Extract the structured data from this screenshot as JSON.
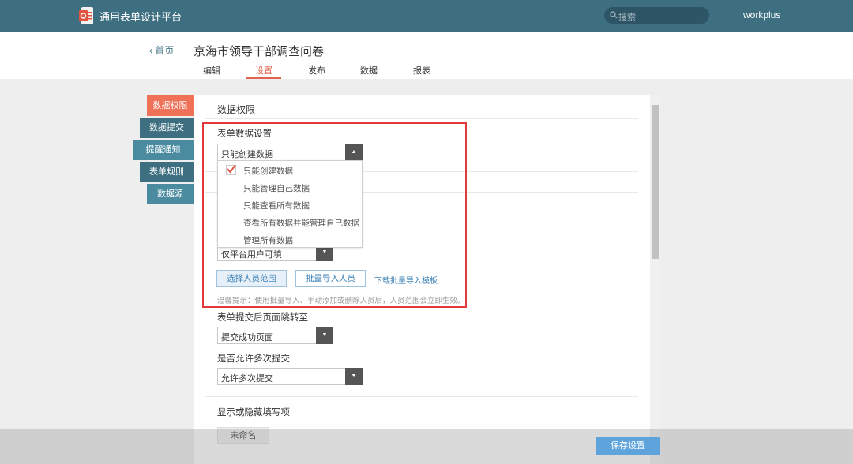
{
  "app": {
    "title": "通用表单设计平台"
  },
  "header": {
    "search_placeholder": "搜索",
    "user": "workplus"
  },
  "nav": {
    "back": "首页",
    "page_title": "京海市领导干部调查问卷"
  },
  "tabs": [
    {
      "label": "编辑"
    },
    {
      "label": "设置",
      "active": true
    },
    {
      "label": "发布"
    },
    {
      "label": "数据"
    },
    {
      "label": "报表"
    }
  ],
  "sidebar": [
    {
      "label": "数据权限",
      "active": true
    },
    {
      "label": "数据提交"
    },
    {
      "label": "提醒通知"
    },
    {
      "label": "表单规则"
    },
    {
      "label": "数据源"
    }
  ],
  "section": {
    "title": "数据权限",
    "form_data_label": "表单数据设置",
    "form_data_value": "只能创建数据",
    "options": [
      "只能创建数据",
      "只能管理自己数据",
      "只能查看所有数据",
      "查看所有数据并能管理自己数据",
      "管理所有数据"
    ],
    "fill_scope_value": "仅平台用户可填",
    "select_range_button": "选择人员范围",
    "batch_import_button": "批量导入人员",
    "download_template_link": "下载批量导入模板",
    "hint": "温馨提示：使用批量导入、手动添加或删除人员后，人员范围会立即生效。",
    "redirect_label": "表单提交后页面跳转至",
    "redirect_value": "提交成功页面",
    "multi_submit_label": "是否允许多次提交",
    "multi_submit_value": "允许多次提交",
    "show_hide_label": "显示或隐藏填写项",
    "chip": "未命名"
  },
  "footer": {
    "save_button": "保存设置"
  },
  "colors": {
    "topbar": "#3d6f81",
    "accent": "#e0624f",
    "save": "#5ea3dc"
  }
}
